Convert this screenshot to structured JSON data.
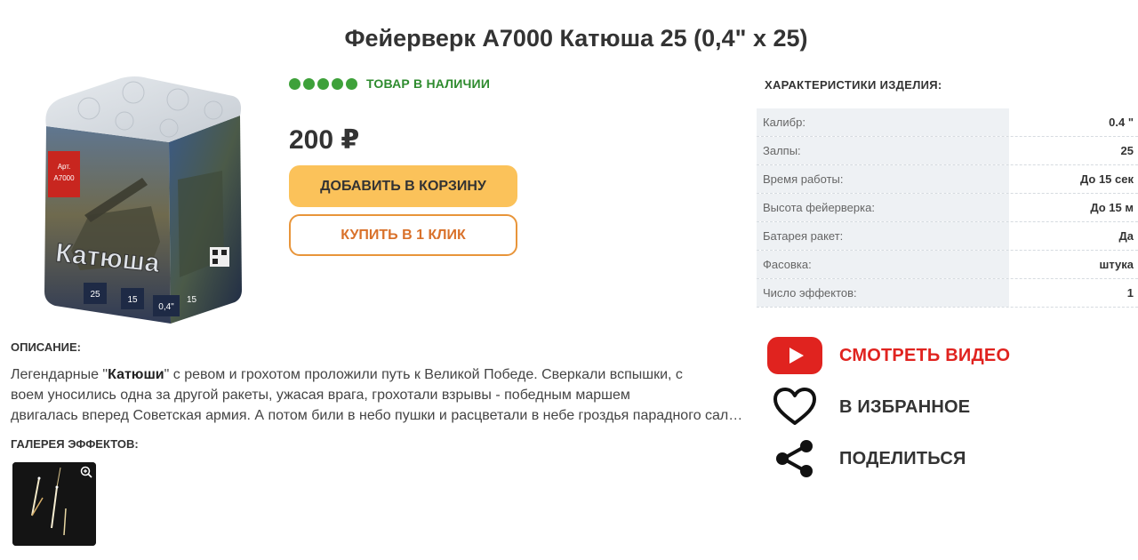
{
  "product": {
    "title": "Фейерверк А7000 Катюша 25 (0,4\" х 25)",
    "image_icon": "firework-battery-box-image",
    "box_article": "Арт. А7000",
    "box_name": "Катюша",
    "box_stat_shots": "25",
    "box_stat_time": "15",
    "box_stat_caliber": "0,4\"",
    "box_stat_effects": "15",
    "stock": {
      "rating_dots": 5,
      "label": "ТОВАР В НАЛИЧИИ",
      "color": "#3ea13a"
    },
    "price": "200 ₽",
    "buttons": {
      "add_to_cart": "ДОБАВИТЬ В КОРЗИНУ",
      "buy_one_click": "КУПИТЬ В 1 КЛИК"
    }
  },
  "specs": {
    "title": "ХАРАКТЕРИСТИКИ ИЗДЕЛИЯ:",
    "rows": [
      {
        "name": "Калибр:",
        "value": "0.4 \""
      },
      {
        "name": "Залпы:",
        "value": "25"
      },
      {
        "name": "Время работы:",
        "value": "До 15 сек"
      },
      {
        "name": "Высота фейерверка:",
        "value": "До 15 м"
      },
      {
        "name": "Батарея ракет:",
        "value": "Да"
      },
      {
        "name": "Фасовка:",
        "value": "штука"
      },
      {
        "name": "Число эффектов:",
        "value": "1"
      }
    ]
  },
  "actions": {
    "video": {
      "label": "СМОТРЕТЬ ВИДЕО",
      "icon": "youtube-play-icon",
      "color": "#e0231f"
    },
    "favorite": {
      "label": "В ИЗБРАННОЕ",
      "icon": "heart-icon"
    },
    "share": {
      "label": "ПОДЕЛИТЬСЯ",
      "icon": "share-icon"
    }
  },
  "description": {
    "title": "ОПИСАНИЕ:",
    "line1_pre": "Легендарные \"",
    "line1_bold": "Катюши",
    "line1_post": "\" с ревом и грохотом проложили путь к Великой Победе. Сверкали вспышки, с",
    "line2": "воем уносились одна за другой ракеты, ужасая врага, грохотали взрывы - победным маршем",
    "line3": "двигалась вперед Советская армия. А потом били в небо пушки и расцветали в небе гроздья парадного салюта"
  },
  "gallery": {
    "title": "ГАЛЕРЕЯ ЭФФЕКТОВ:",
    "thumb_icon": "zoom-in-icon"
  }
}
